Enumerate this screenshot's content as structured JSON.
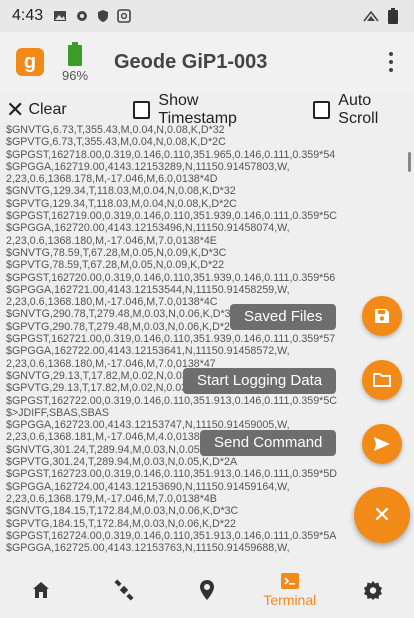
{
  "status_bar": {
    "time": "4:43"
  },
  "header": {
    "logo_letter": "g",
    "battery_pct": "96%",
    "device_name": "Geode GiP1-003"
  },
  "toolbar": {
    "clear_label": "Clear",
    "show_timestamp_label": "Show Timestamp",
    "auto_scroll_label": "Auto Scroll"
  },
  "terminal": {
    "lines": [
      "$GNVTG,6.73,T,355.43,M,0.04,N,0.08,K,D*32",
      "$GPVTG,6.73,T,355.43,M,0.04,N,0.08,K,D*2C",
      "$GPGST,162718.00,0.319,0.146,0.110,351.965,0.146,0.111,0.359*54",
      "$GPGGA,162719.00,4143.12153289,N,11150.91457803,W,",
      "2,23,0.6,1368.178,M,-17.046,M,6.0,0138*4D",
      "$GNVTG,129.34,T,118.03,M,0.04,N,0.08,K,D*32",
      "$GPVTG,129.34,T,118.03,M,0.04,N,0.08,K,D*2C",
      "$GPGST,162719.00,0.319,0.146,0.110,351.939,0.146,0.111,0.359*5C",
      "$GPGGA,162720.00,4143.12153496,N,11150.91458074,W,",
      "2,23,0.6,1368.180,M,-17.046,M,7.0,0138*4E",
      "$GNVTG,78.59,T,67.28,M,0.05,N,0.09,K,D*3C",
      "$GPVTG,78.59,T,67.28,M,0.05,N,0.09,K,D*22",
      "$GPGST,162720.00,0.319,0.146,0.110,351.939,0.146,0.111,0.359*56",
      "$GPGGA,162721.00,4143.12153544,N,11150.91458259,W,",
      "2,23,0.6,1368.180,M,-17.046,M,7.0,0138*4C",
      "$GNVTG,290.78,T,279.48,M,0.03,N,0.06,K,D*39",
      "$GPVTG,290.78,T,279.48,M,0.03,N,0.06,K,D*27",
      "$GPGST,162721.00,0.319,0.146,0.110,351.939,0.146,0.111,0.359*57",
      "$GPGGA,162722.00,4143.12153641,N,11150.91458572,W,",
      "2,23,0.6,1368.180,M,-17.046,M,7.0,0138*47",
      "$GNVTG,29.13,T,17.82,M,0.02,N,0.03,K,D*",
      "$GPVTG,29.13,T,17.82,M,0.02,N,0.03,K,D*",
      "$GPGST,162722.00,0.319,0.146,0.110,351.913,0.146,0.111,0.359*5C",
      "$>JDIFF,SBAS,SBAS",
      "$GPGGA,162723.00,4143.12153747,N,11150.91459005,W,",
      "2,23,0.6,1368.181,M,-17.046,M,4.0,0138*4",
      "$GNVTG,301.24,T,289.94,M,0.03,N,0.05,K,D*",
      "$GPVTG,301.24,T,289.94,M,0.03,N,0.05,K,D*2A",
      "$GPGST,162723.00,0.319,0.146,0.110,351.913,0.146,0.111,0.359*5D",
      "$GPGGA,162724.00,4143.12153690,N,11150.91459164,W,",
      "2,23,0.6,1368.179,M,-17.046,M,7.0,0138*4B",
      "$GNVTG,184.15,T,172.84,M,0.03,N,0.06,K,D*3C",
      "$GPVTG,184.15,T,172.84,M,0.03,N,0.06,K,D*22",
      "$GPGST,162724.00,0.319,0.146,0.110,351.913,0.146,0.111,0.359*5A",
      "$GPGGA,162725.00,4143.12153763,N,11150.91459688,W,"
    ]
  },
  "fab_menu": {
    "saved_files_label": "Saved Files",
    "start_logging_label": "Start Logging Data",
    "send_command_label": "Send Command"
  },
  "bottom_nav": {
    "terminal_label": "Terminal"
  },
  "colors": {
    "accent": "#f28a18",
    "label_bg": "#6e6e6e"
  }
}
